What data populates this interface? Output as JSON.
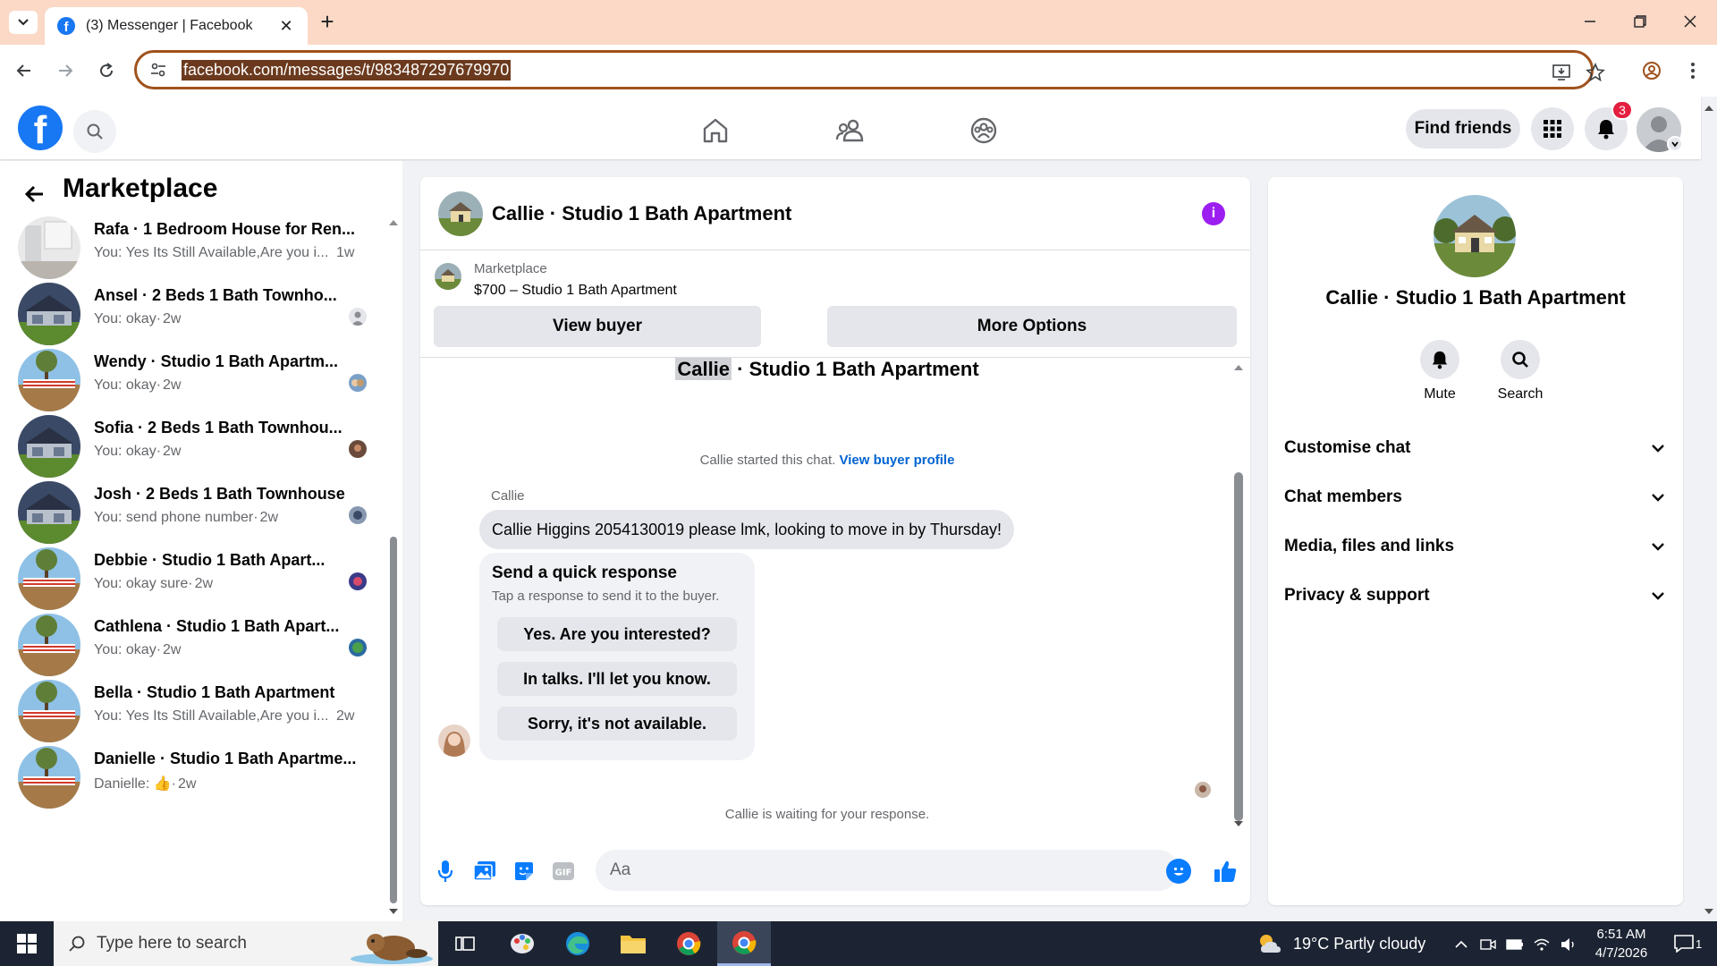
{
  "browser": {
    "tab_title": "(3) Messenger | Facebook",
    "url": "facebook.com/messages/t/983487297679970"
  },
  "header": {
    "find_friends_label": "Find friends",
    "notification_count": "3",
    "brand_color": "#1877f2"
  },
  "sidebar": {
    "title": "Marketplace",
    "chats": [
      {
        "title": "Rafa · 1 Bedroom House for Ren...",
        "preview": "You: Yes Its Still Available,Are you i...",
        "time": "1w",
        "thumb": "room"
      },
      {
        "title": "Ansel · 2 Beds 1 Bath Townho...",
        "preview": "You: okay",
        "time": "2w",
        "thumb": "townhouse"
      },
      {
        "title": "Wendy · Studio 1 Bath Apartm...",
        "preview": "You: okay",
        "time": "2w",
        "thumb": "yard"
      },
      {
        "title": "Sofia · 2 Beds 1 Bath Townhou...",
        "preview": "You: okay",
        "time": "2w",
        "thumb": "townhouse"
      },
      {
        "title": "Josh · 2 Beds 1 Bath Townhouse",
        "preview": "You: send phone number",
        "time": "2w",
        "thumb": "townhouse"
      },
      {
        "title": "Debbie · Studio 1 Bath Apart...",
        "preview": "You: okay sure",
        "time": "2w",
        "thumb": "yard"
      },
      {
        "title": "Cathlena · Studio 1 Bath Apart...",
        "preview": "You: okay",
        "time": "2w",
        "thumb": "yard"
      },
      {
        "title": "Bella · Studio 1 Bath Apartment",
        "preview": "You: Yes Its Still Available,Are you i...",
        "time": "2w",
        "thumb": "yard"
      },
      {
        "title": "Danielle · Studio 1 Bath Apartme...",
        "preview": "Danielle: 👍",
        "time": "2w",
        "thumb": "yard"
      }
    ]
  },
  "chat": {
    "title": "Callie · Studio 1 Bath Apartment",
    "marketplace_label": "Marketplace",
    "listing": "$700 – Studio 1 Bath Apartment",
    "view_buyer_label": "View buyer",
    "more_options_label": "More Options",
    "top_name_first": "Callie",
    "top_name_rest": " · Studio 1 Bath Apartment",
    "started_text": "Callie started this chat.",
    "view_buyer_profile_label": "View buyer profile",
    "sender": "Callie",
    "message": "Callie Higgins 2054130019 please lmk, looking to move in by Thursday!",
    "quick_response_title": "Send a quick response",
    "quick_response_sub": "Tap a response to send it to the buyer.",
    "quick_responses": [
      "Yes. Are you interested?",
      "In talks. I'll let you know.",
      "Sorry, it's not available."
    ],
    "waiting_text": "Callie is waiting for your response.",
    "composer_placeholder": "Aa"
  },
  "info_panel": {
    "title": "Callie · Studio 1 Bath Apartment",
    "actions": [
      "Mute",
      "Search"
    ],
    "sections": [
      "Customise chat",
      "Chat members",
      "Media, files and links",
      "Privacy & support"
    ]
  },
  "taskbar": {
    "search_placeholder": "Type here to search",
    "weather": "19°C  Partly cloudy",
    "time": "6:51 AM",
    "date": "4/7/2026",
    "notifications": "1"
  }
}
